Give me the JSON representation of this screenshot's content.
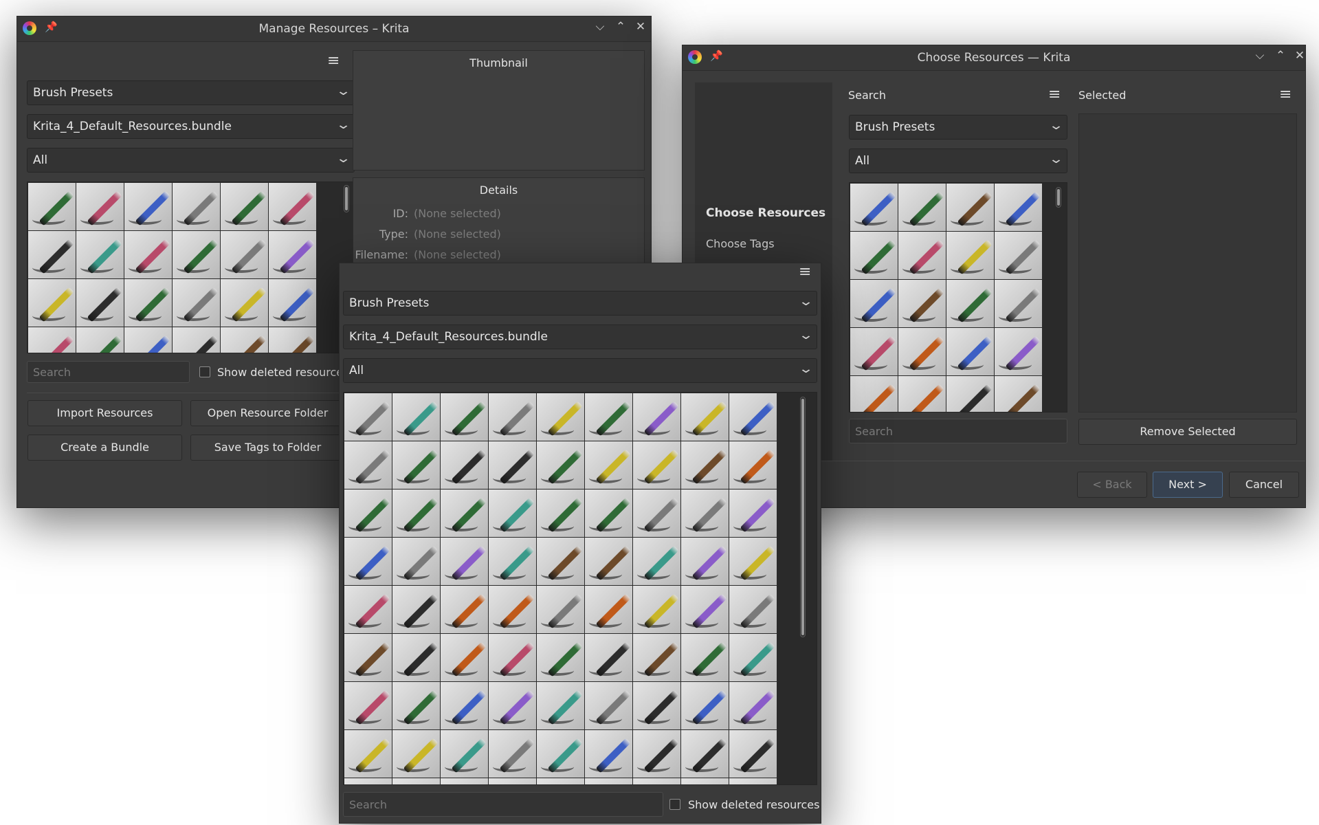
{
  "manage": {
    "title": "Manage Resources – Krita",
    "type_combo": "Brush Presets",
    "bundle_combo": "Krita_4_Default_Resources.bundle",
    "tag_combo": "All",
    "search_placeholder": "Search",
    "show_deleted": "Show deleted resources",
    "thumbnail_title": "Thumbnail",
    "details_title": "Details",
    "id_label": "ID:",
    "id_value": "(None selected)",
    "type_label": "Type:",
    "type_value": "(None selected)",
    "filename_label": "Filename:",
    "filename_value": "(None selected)",
    "buttons": {
      "import": "Import Resources",
      "open_folder": "Open Resource Folder",
      "create_bundle": "Create a Bundle",
      "save_tags": "Save Tags to Folder"
    }
  },
  "choose": {
    "title": "Choose Resources — Krita",
    "nav": {
      "resources": "Choose Resources",
      "tags": "Choose Tags"
    },
    "search_label": "Search",
    "selected_label": "Selected",
    "type_combo": "Brush Presets",
    "tag_combo": "All",
    "search_placeholder": "Search",
    "remove_selected": "Remove Selected",
    "back": "< Back",
    "next": "Next >",
    "cancel": "Cancel"
  },
  "chooser": {
    "type_combo": "Brush Presets",
    "bundle_combo": "Krita_4_Default_Resources.bundle",
    "tag_combo": "All",
    "search_placeholder": "Search",
    "show_deleted": "Show deleted resources"
  }
}
